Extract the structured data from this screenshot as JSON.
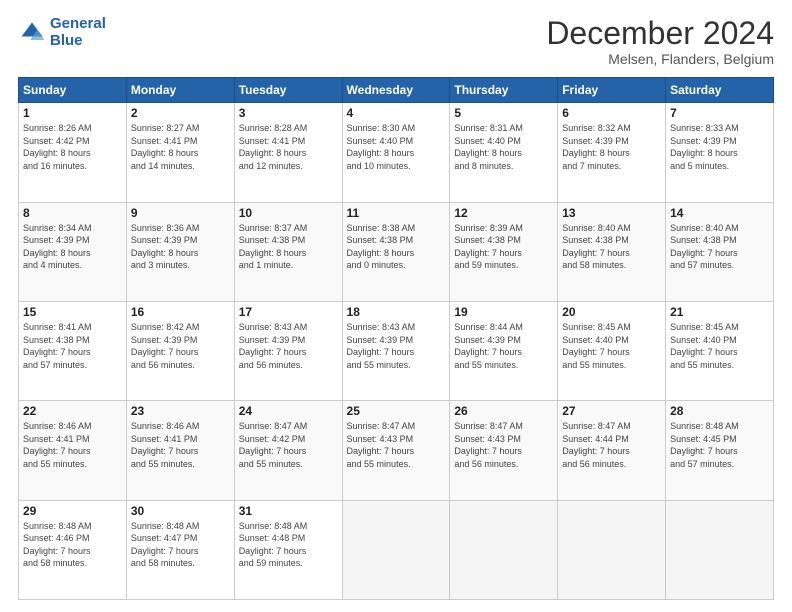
{
  "header": {
    "logo_line1": "General",
    "logo_line2": "Blue",
    "title": "December 2024",
    "subtitle": "Melsen, Flanders, Belgium"
  },
  "calendar": {
    "days_of_week": [
      "Sunday",
      "Monday",
      "Tuesday",
      "Wednesday",
      "Thursday",
      "Friday",
      "Saturday"
    ],
    "weeks": [
      [
        {
          "day": "1",
          "info": "Sunrise: 8:26 AM\nSunset: 4:42 PM\nDaylight: 8 hours\nand 16 minutes."
        },
        {
          "day": "2",
          "info": "Sunrise: 8:27 AM\nSunset: 4:41 PM\nDaylight: 8 hours\nand 14 minutes."
        },
        {
          "day": "3",
          "info": "Sunrise: 8:28 AM\nSunset: 4:41 PM\nDaylight: 8 hours\nand 12 minutes."
        },
        {
          "day": "4",
          "info": "Sunrise: 8:30 AM\nSunset: 4:40 PM\nDaylight: 8 hours\nand 10 minutes."
        },
        {
          "day": "5",
          "info": "Sunrise: 8:31 AM\nSunset: 4:40 PM\nDaylight: 8 hours\nand 8 minutes."
        },
        {
          "day": "6",
          "info": "Sunrise: 8:32 AM\nSunset: 4:39 PM\nDaylight: 8 hours\nand 7 minutes."
        },
        {
          "day": "7",
          "info": "Sunrise: 8:33 AM\nSunset: 4:39 PM\nDaylight: 8 hours\nand 5 minutes."
        }
      ],
      [
        {
          "day": "8",
          "info": "Sunrise: 8:34 AM\nSunset: 4:39 PM\nDaylight: 8 hours\nand 4 minutes."
        },
        {
          "day": "9",
          "info": "Sunrise: 8:36 AM\nSunset: 4:39 PM\nDaylight: 8 hours\nand 3 minutes."
        },
        {
          "day": "10",
          "info": "Sunrise: 8:37 AM\nSunset: 4:38 PM\nDaylight: 8 hours\nand 1 minute."
        },
        {
          "day": "11",
          "info": "Sunrise: 8:38 AM\nSunset: 4:38 PM\nDaylight: 8 hours\nand 0 minutes."
        },
        {
          "day": "12",
          "info": "Sunrise: 8:39 AM\nSunset: 4:38 PM\nDaylight: 7 hours\nand 59 minutes."
        },
        {
          "day": "13",
          "info": "Sunrise: 8:40 AM\nSunset: 4:38 PM\nDaylight: 7 hours\nand 58 minutes."
        },
        {
          "day": "14",
          "info": "Sunrise: 8:40 AM\nSunset: 4:38 PM\nDaylight: 7 hours\nand 57 minutes."
        }
      ],
      [
        {
          "day": "15",
          "info": "Sunrise: 8:41 AM\nSunset: 4:38 PM\nDaylight: 7 hours\nand 57 minutes."
        },
        {
          "day": "16",
          "info": "Sunrise: 8:42 AM\nSunset: 4:39 PM\nDaylight: 7 hours\nand 56 minutes."
        },
        {
          "day": "17",
          "info": "Sunrise: 8:43 AM\nSunset: 4:39 PM\nDaylight: 7 hours\nand 56 minutes."
        },
        {
          "day": "18",
          "info": "Sunrise: 8:43 AM\nSunset: 4:39 PM\nDaylight: 7 hours\nand 55 minutes."
        },
        {
          "day": "19",
          "info": "Sunrise: 8:44 AM\nSunset: 4:39 PM\nDaylight: 7 hours\nand 55 minutes."
        },
        {
          "day": "20",
          "info": "Sunrise: 8:45 AM\nSunset: 4:40 PM\nDaylight: 7 hours\nand 55 minutes."
        },
        {
          "day": "21",
          "info": "Sunrise: 8:45 AM\nSunset: 4:40 PM\nDaylight: 7 hours\nand 55 minutes."
        }
      ],
      [
        {
          "day": "22",
          "info": "Sunrise: 8:46 AM\nSunset: 4:41 PM\nDaylight: 7 hours\nand 55 minutes."
        },
        {
          "day": "23",
          "info": "Sunrise: 8:46 AM\nSunset: 4:41 PM\nDaylight: 7 hours\nand 55 minutes."
        },
        {
          "day": "24",
          "info": "Sunrise: 8:47 AM\nSunset: 4:42 PM\nDaylight: 7 hours\nand 55 minutes."
        },
        {
          "day": "25",
          "info": "Sunrise: 8:47 AM\nSunset: 4:43 PM\nDaylight: 7 hours\nand 55 minutes."
        },
        {
          "day": "26",
          "info": "Sunrise: 8:47 AM\nSunset: 4:43 PM\nDaylight: 7 hours\nand 56 minutes."
        },
        {
          "day": "27",
          "info": "Sunrise: 8:47 AM\nSunset: 4:44 PM\nDaylight: 7 hours\nand 56 minutes."
        },
        {
          "day": "28",
          "info": "Sunrise: 8:48 AM\nSunset: 4:45 PM\nDaylight: 7 hours\nand 57 minutes."
        }
      ],
      [
        {
          "day": "29",
          "info": "Sunrise: 8:48 AM\nSunset: 4:46 PM\nDaylight: 7 hours\nand 58 minutes."
        },
        {
          "day": "30",
          "info": "Sunrise: 8:48 AM\nSunset: 4:47 PM\nDaylight: 7 hours\nand 58 minutes."
        },
        {
          "day": "31",
          "info": "Sunrise: 8:48 AM\nSunset: 4:48 PM\nDaylight: 7 hours\nand 59 minutes."
        },
        {
          "day": "",
          "info": ""
        },
        {
          "day": "",
          "info": ""
        },
        {
          "day": "",
          "info": ""
        },
        {
          "day": "",
          "info": ""
        }
      ]
    ]
  }
}
